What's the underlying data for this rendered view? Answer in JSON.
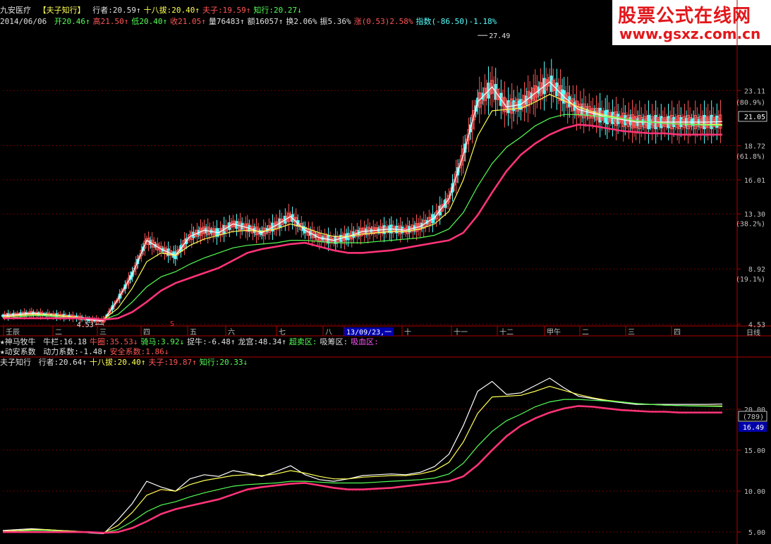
{
  "header": {
    "stock_name": "九安医疗",
    "indicator": "【夫子知行】",
    "items": [
      {
        "text": "行者:20.59↑",
        "color": "#e0e0e0"
      },
      {
        "text": "十八拔:20.40↑",
        "color": "#ffff55"
      },
      {
        "text": "夫子:19.59↑",
        "color": "#ff5555"
      },
      {
        "text": "知行:20.27↓",
        "color": "#55ff55"
      }
    ]
  },
  "quote": {
    "date": "2014/06/06",
    "items": [
      {
        "text": "开20.46↑",
        "color": "#55ff55"
      },
      {
        "text": "高21.50↑",
        "color": "#ff5555"
      },
      {
        "text": "低20.40↑",
        "color": "#55ff55"
      },
      {
        "text": "收21.05↑",
        "color": "#ff5555"
      },
      {
        "text": "量76483↑",
        "color": "#e0e0e0"
      },
      {
        "text": "额16057↑",
        "color": "#e0e0e0"
      },
      {
        "text": "换2.06%",
        "color": "#e0e0e0"
      },
      {
        "text": "振5.36%",
        "color": "#e0e0e0"
      },
      {
        "text": "涨(0.53)2.58%",
        "color": "#ff5555"
      },
      {
        "text": "指数(-86.50)-1.18%",
        "color": "#55ffff"
      }
    ]
  },
  "watermark": {
    "line1": "股票公式在线网",
    "line2": "www.gsxz.com.cn"
  },
  "main_price_axis": [
    {
      "v": 23.11,
      "label": "23.11"
    },
    {
      "v": 22.2,
      "label": "(80.9%)",
      "pct": true
    },
    {
      "v": 18.72,
      "label": "18.72"
    },
    {
      "v": 17.9,
      "label": "(61.8%)",
      "pct": true
    },
    {
      "v": 16.01,
      "label": "16.01"
    },
    {
      "v": 13.3,
      "label": "13.30"
    },
    {
      "v": 12.55,
      "label": "(38.2%)",
      "pct": true
    },
    {
      "v": 8.92,
      "label": "8.92"
    },
    {
      "v": 8.15,
      "label": "(19.1%)",
      "pct": true
    },
    {
      "v": 4.53,
      "label": "4.53"
    }
  ],
  "current_price": "21.05",
  "high_marker": "27.49",
  "low_marker": "4.53",
  "s_marker": "S",
  "time_axis": [
    "壬辰",
    "二",
    "三",
    "四",
    "五",
    "六",
    "七",
    "八",
    "13/09/23,一",
    "十",
    "十一",
    "十二",
    "甲午",
    "二",
    "三",
    "四"
  ],
  "period_label": "日线",
  "ind1": {
    "title": "★神马牧牛",
    "items": [
      {
        "text": "牛栏:16.18",
        "color": "#e0e0e0"
      },
      {
        "text": "牛圈:35.53↓",
        "color": "#ff5555"
      },
      {
        "text": "骑马:3.92↓",
        "color": "#55ff55"
      },
      {
        "text": "捉牛:-6.48↑",
        "color": "#e0e0e0"
      },
      {
        "text": "龙宫:48.34↑",
        "color": "#e0e0e0"
      },
      {
        "text": "超卖区:",
        "color": "#55ff55"
      },
      {
        "text": "吸筹区:",
        "color": "#e0e0e0"
      },
      {
        "text": "吸血区:",
        "color": "#ff55ff"
      }
    ]
  },
  "ind2": {
    "title": "★动安系数",
    "items": [
      {
        "text": "动力系数:-1.48↑",
        "color": "#e0e0e0"
      },
      {
        "text": "安全系数:1.86↓",
        "color": "#ff5555"
      }
    ]
  },
  "ind3": {
    "title": "夫子知行",
    "items": [
      {
        "text": "行者:20.64↑",
        "color": "#e0e0e0"
      },
      {
        "text": "十八拔:20.40↑",
        "color": "#ffff55"
      },
      {
        "text": "夫子:19.87↑",
        "color": "#ff5555"
      },
      {
        "text": "知行:20.33↓",
        "color": "#55ff55"
      }
    ]
  },
  "lower_axis": [
    {
      "v": 20.0,
      "label": "20.00"
    },
    {
      "v": 15.0,
      "label": "15.00"
    },
    {
      "v": 10.0,
      "label": "10.00"
    },
    {
      "v": 5.0,
      "label": "5.00"
    }
  ],
  "lower_boxes": [
    "(789)",
    "16.49"
  ],
  "chart_data": {
    "type": "line",
    "x": [
      0,
      1,
      2,
      3,
      4,
      5,
      6,
      7,
      8,
      9,
      10,
      11,
      12,
      13,
      14,
      15,
      16,
      17,
      18,
      19,
      20,
      21,
      22,
      23,
      24,
      25,
      26,
      27,
      28,
      29,
      30,
      31,
      32,
      33,
      34,
      35,
      36,
      37,
      38,
      39,
      40,
      41,
      42,
      43,
      44,
      45,
      46,
      47,
      48,
      49,
      50
    ],
    "series": [
      {
        "name": "行者",
        "color": "#ffffff",
        "values": [
          5.2,
          5.3,
          5.4,
          5.3,
          5.2,
          5.1,
          4.9,
          4.8,
          6.5,
          8.5,
          11.2,
          10.5,
          10.0,
          11.5,
          12.0,
          11.8,
          12.5,
          12.2,
          11.8,
          12.4,
          13.1,
          12.0,
          11.4,
          11.2,
          11.5,
          11.9,
          12.0,
          12.1,
          12.0,
          12.3,
          13.0,
          14.5,
          18.0,
          22.2,
          23.4,
          21.8,
          22.0,
          22.9,
          23.8,
          22.6,
          21.6,
          21.3,
          21.0,
          20.8,
          20.6,
          20.6,
          20.6,
          20.6,
          20.6,
          20.6,
          20.64
        ]
      },
      {
        "name": "十八拔",
        "color": "#ffff55",
        "values": [
          5.1,
          5.2,
          5.3,
          5.3,
          5.2,
          5.1,
          5.0,
          4.9,
          5.8,
          7.4,
          9.5,
          10.2,
          10.0,
          10.8,
          11.3,
          11.6,
          11.9,
          12.0,
          11.9,
          12.1,
          12.5,
          12.2,
          11.8,
          11.5,
          11.5,
          11.7,
          11.8,
          11.9,
          11.9,
          12.1,
          12.5,
          13.5,
          16.0,
          19.5,
          21.5,
          21.6,
          21.7,
          22.2,
          22.8,
          22.3,
          21.8,
          21.4,
          21.1,
          20.9,
          20.7,
          20.6,
          20.5,
          20.45,
          20.42,
          20.41,
          20.4
        ]
      },
      {
        "name": "知行",
        "color": "#55ff55",
        "values": [
          5.0,
          5.1,
          5.2,
          5.2,
          5.1,
          5.0,
          5.0,
          4.9,
          5.3,
          6.3,
          7.5,
          8.3,
          8.7,
          9.3,
          9.8,
          10.2,
          10.6,
          10.8,
          10.9,
          11.0,
          11.2,
          11.2,
          11.1,
          11.0,
          11.0,
          11.0,
          11.1,
          11.2,
          11.3,
          11.4,
          11.6,
          12.1,
          13.4,
          15.5,
          17.3,
          18.6,
          19.4,
          20.3,
          20.9,
          21.2,
          21.2,
          21.1,
          21.0,
          20.9,
          20.7,
          20.6,
          20.5,
          20.45,
          20.4,
          20.36,
          20.33
        ]
      },
      {
        "name": "夫子",
        "color": "#ff3377",
        "values": [
          5.0,
          5.0,
          5.0,
          5.0,
          5.0,
          5.0,
          5.0,
          4.9,
          5.0,
          5.5,
          6.3,
          7.2,
          7.8,
          8.2,
          8.6,
          9.0,
          9.6,
          10.2,
          10.5,
          10.7,
          10.9,
          11.0,
          10.7,
          10.4,
          10.2,
          10.2,
          10.3,
          10.4,
          10.6,
          10.8,
          11.0,
          11.2,
          11.8,
          13.2,
          15.0,
          16.7,
          18.0,
          18.9,
          19.6,
          20.1,
          20.4,
          20.3,
          20.1,
          19.9,
          19.8,
          19.7,
          19.7,
          19.6,
          19.6,
          19.6,
          19.6
        ]
      }
    ],
    "ylim": [
      4.5,
      27.5
    ],
    "lower_ylim": [
      3.8,
      25.0
    ]
  }
}
